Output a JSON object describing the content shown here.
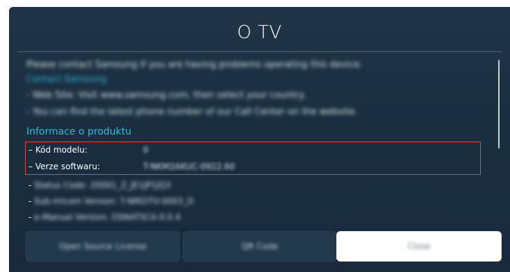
{
  "dialog": {
    "title": "O TV"
  },
  "info_text": {
    "contact_line": "Please contact Samsung if you are having problems operating this device.",
    "contact_link": "Contact Samsung",
    "website_line": "- Web Site: Visit www.samsung.com, then select your country.",
    "callcenter_line": "- You can find the latest phone number of our Call Center on the website."
  },
  "product_info": {
    "heading": "Informace o produktu",
    "rows": [
      {
        "dash": "–",
        "label": "Kód modelu:",
        "value": "0"
      },
      {
        "dash": "–",
        "label": "Verze softwaru:",
        "value": "T-NKM2AKUC-0922.60"
      }
    ],
    "other_rows": [
      {
        "dash": "-",
        "text": "Status Code: 20001_Z_JE1JP1JQ3"
      },
      {
        "dash": "-",
        "text": "Sub-micom Version: T-NM2ITV-0003_D"
      },
      {
        "dash": "-",
        "text": "e-Manual Version: OSNATSCA-0.0.4"
      }
    ]
  },
  "buttons": {
    "open_source": "Open Source License",
    "qr_code": "QR Code",
    "close": "Close"
  }
}
